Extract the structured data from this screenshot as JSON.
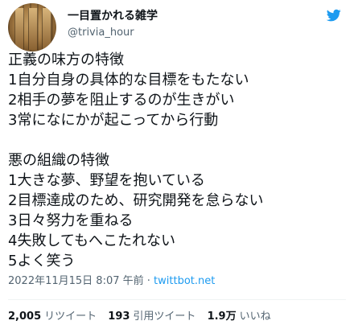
{
  "author": {
    "display_name": "一目置かれる雑学",
    "handle": "@trivia_hour"
  },
  "tweet": {
    "lines": [
      "正義の味方の特徴",
      "1自分自身の具体的な目標をもたない",
      "2相手の夢を阻止するのが生きがい",
      "3常になにかが起こってから行動",
      "",
      "悪の組織の特徴",
      "1大きな夢、野望を抱いている",
      "2目標達成のため、研究開発を怠らない",
      "3日々努力を重ねる",
      "4失敗してもへこたれない",
      "5よく笑う"
    ]
  },
  "meta": {
    "timestamp": "2022年11月15日 8:07 午前",
    "separator": " · ",
    "source": "twittbot.net"
  },
  "stats": {
    "retweets_count": "2,005",
    "retweets_label": "リツイート",
    "quotes_count": "193",
    "quotes_label": "引用ツイート",
    "likes_count": "1.9万",
    "likes_label": "いいね"
  },
  "colors": {
    "text": "#0f1419",
    "secondary": "#536471",
    "link": "#1d9bf0"
  },
  "icons": {
    "brand": "twitter-bird-icon"
  }
}
